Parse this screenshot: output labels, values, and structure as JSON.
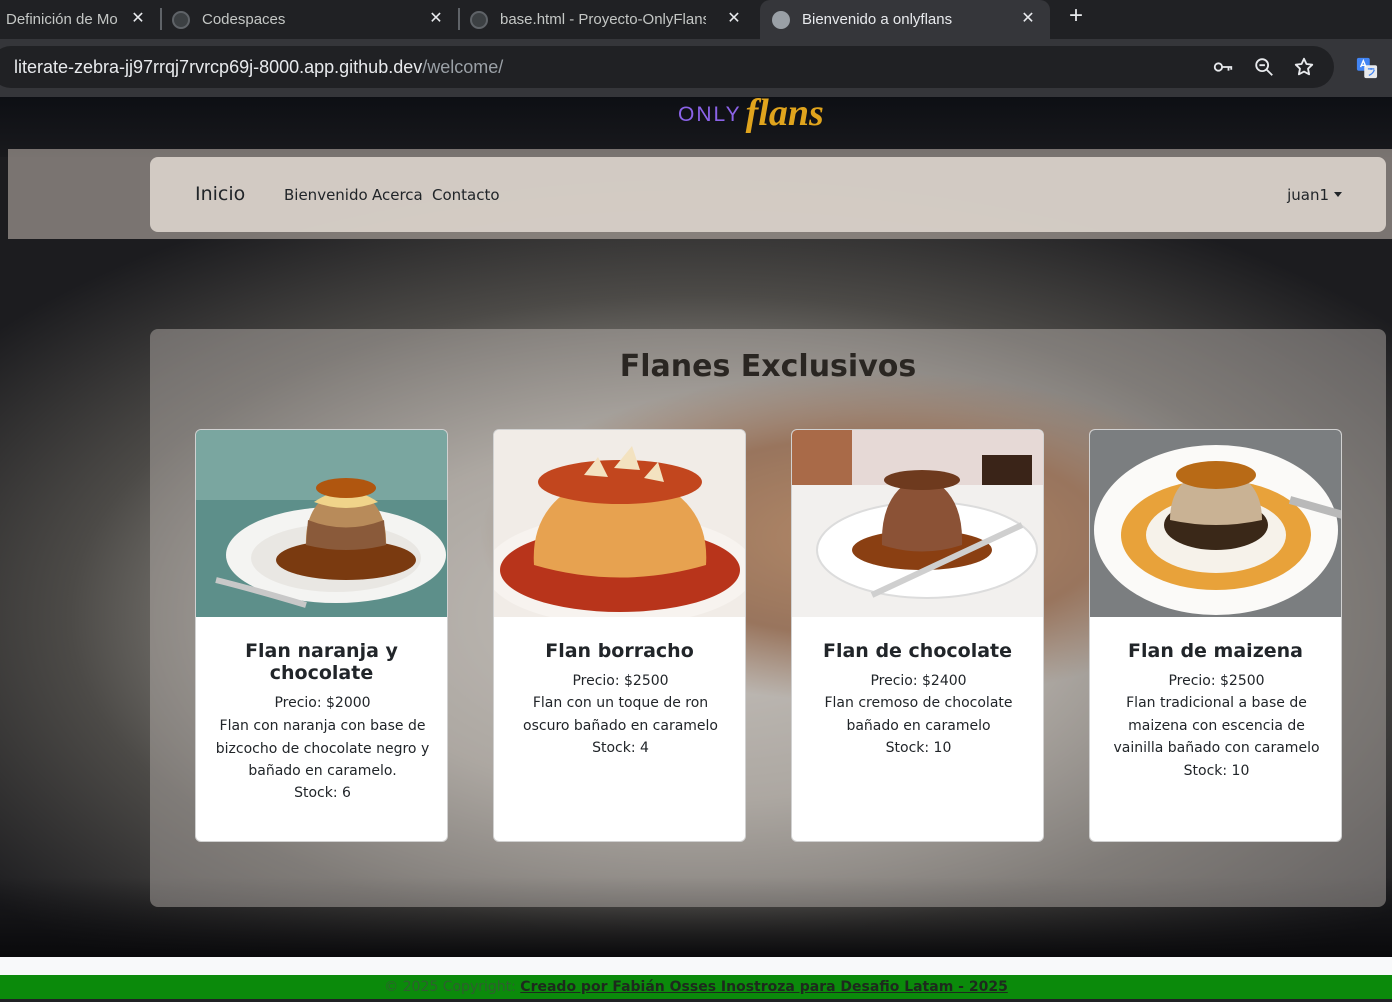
{
  "browser": {
    "tabs": [
      {
        "title": "Definición de Mo",
        "active": false
      },
      {
        "title": "Codespaces",
        "active": false
      },
      {
        "title": "base.html - Proyecto-OnlyFlans",
        "active": false
      },
      {
        "title": "Bienvenido a onlyflans",
        "active": true
      }
    ],
    "new_tab_glyph": "+",
    "close_glyph": "✕",
    "url_host": "literate-zebra-jj97rrqj7rvrcp69j-8000.app.github.dev",
    "url_path": "/welcome/"
  },
  "site": {
    "logo_only": "ONLY",
    "logo_flans": "flans",
    "nav": {
      "brand": "Inicio",
      "links": [
        "Bienvenido",
        "Acerca",
        "Contacto"
      ],
      "user": "juan1"
    },
    "section_title": "Flanes Exclusivos",
    "cards": [
      {
        "name": "Flan naranja y chocolate",
        "price": "Precio: $2000",
        "description": "Flan con naranja con base de bizcocho de chocolate negro y bañado en caramelo.",
        "stock": "Stock: 6"
      },
      {
        "name": "Flan borracho",
        "price": "Precio: $2500",
        "description": "Flan con un toque de ron oscuro bañado en caramelo",
        "stock": "Stock: 4"
      },
      {
        "name": "Flan de chocolate",
        "price": "Precio: $2400",
        "description": "Flan cremoso de chocolate bañado en caramelo",
        "stock": "Stock: 10"
      },
      {
        "name": "Flan de maizena",
        "price": "Precio: $2500",
        "description": "Flan tradicional a base de maizena con escencia de vainilla bañado con caramelo",
        "stock": "Stock: 10"
      }
    ],
    "footer": {
      "text": "© 2025 Copyright: ",
      "link": "Creado por Fabián Osses Inostroza para Desafio Latam - 2025"
    }
  },
  "colors": {
    "accent_green": "#0b8a0b",
    "logo_purple": "#8b63e8",
    "logo_gold": "#e0a41d"
  }
}
